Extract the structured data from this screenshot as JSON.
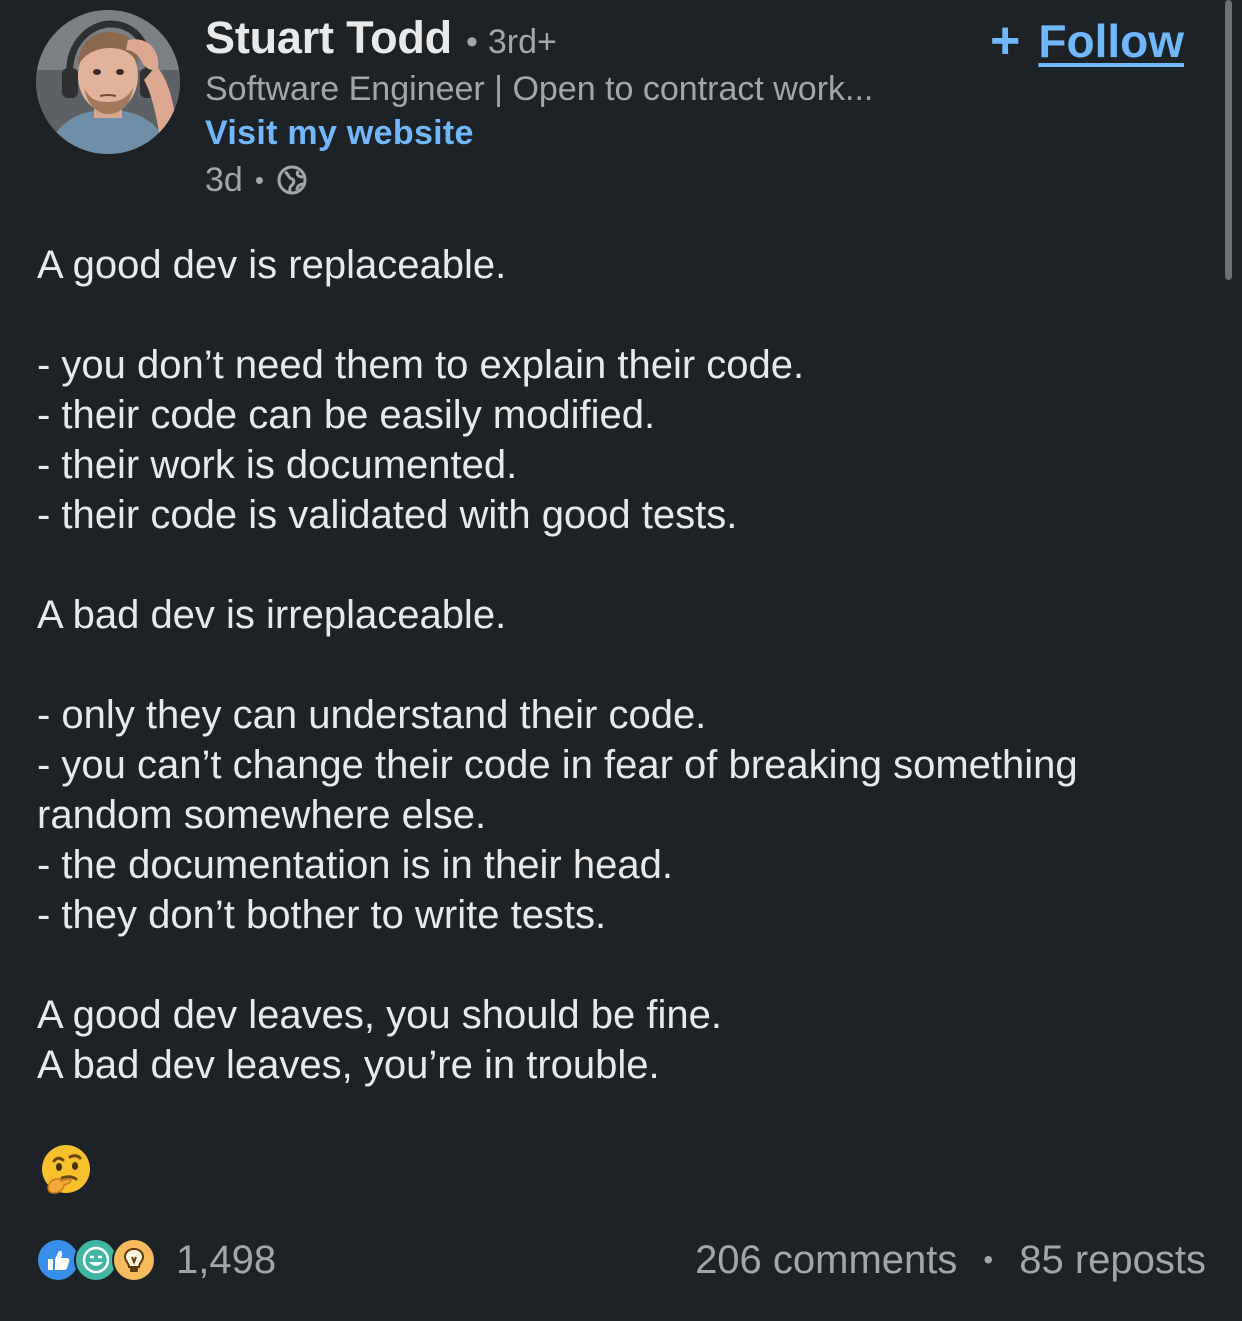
{
  "author": {
    "name": "Stuart Todd",
    "degree": "3rd+",
    "headline": "Software Engineer | Open to contract work...",
    "website_label": "Visit my website",
    "time_ago": "3d",
    "visibility_icon": "globe-icon"
  },
  "follow": {
    "plus": "+",
    "label": "Follow"
  },
  "post": {
    "lines": [
      "A good dev is replaceable.",
      "",
      "- you don’t need them to explain their code.",
      "- their code can be easily modified.",
      "- their work is documented.",
      "- their code is validated with good tests.",
      "",
      "A bad dev is irreplaceable.",
      "",
      "- only they can understand their code.",
      "- you can’t change their code in fear of breaking something random somewhere else.",
      "- the documentation is in their head.",
      "- they don’t bother to write tests.",
      "",
      "A good dev leaves, you should be fine.",
      "A bad dev leaves, you’re in trouble."
    ],
    "emoji": "thinking-face-emoji"
  },
  "social": {
    "reaction_icons": [
      "like-icon",
      "funny-icon",
      "insightful-icon"
    ],
    "reaction_count": "1,498",
    "comments": "206 comments",
    "separator": "•",
    "reposts": "85 reposts"
  },
  "colors": {
    "background": "#1d2226",
    "link_blue": "#71b7fb",
    "muted_text": "#a3a6a9",
    "primary_text": "#e9e9e9"
  }
}
